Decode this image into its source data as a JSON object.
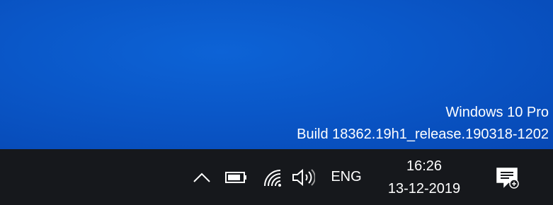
{
  "watermark": {
    "edition": "Windows 10 Pro",
    "build": "Build 18362.19h1_release.190318-1202"
  },
  "taskbar": {
    "tray": {
      "show_hidden_icon": "chevron-up-icon",
      "battery_icon": "battery-icon",
      "network_icon": "wifi-icon",
      "volume_icon": "speaker-icon",
      "language": "ENG"
    },
    "clock": {
      "time": "16:26",
      "date": "13-12-2019"
    },
    "action_center_icon": "notification-icon"
  },
  "colors": {
    "desktop_blue": "#0a57c8",
    "taskbar": "#16181c",
    "text": "#ffffff"
  }
}
